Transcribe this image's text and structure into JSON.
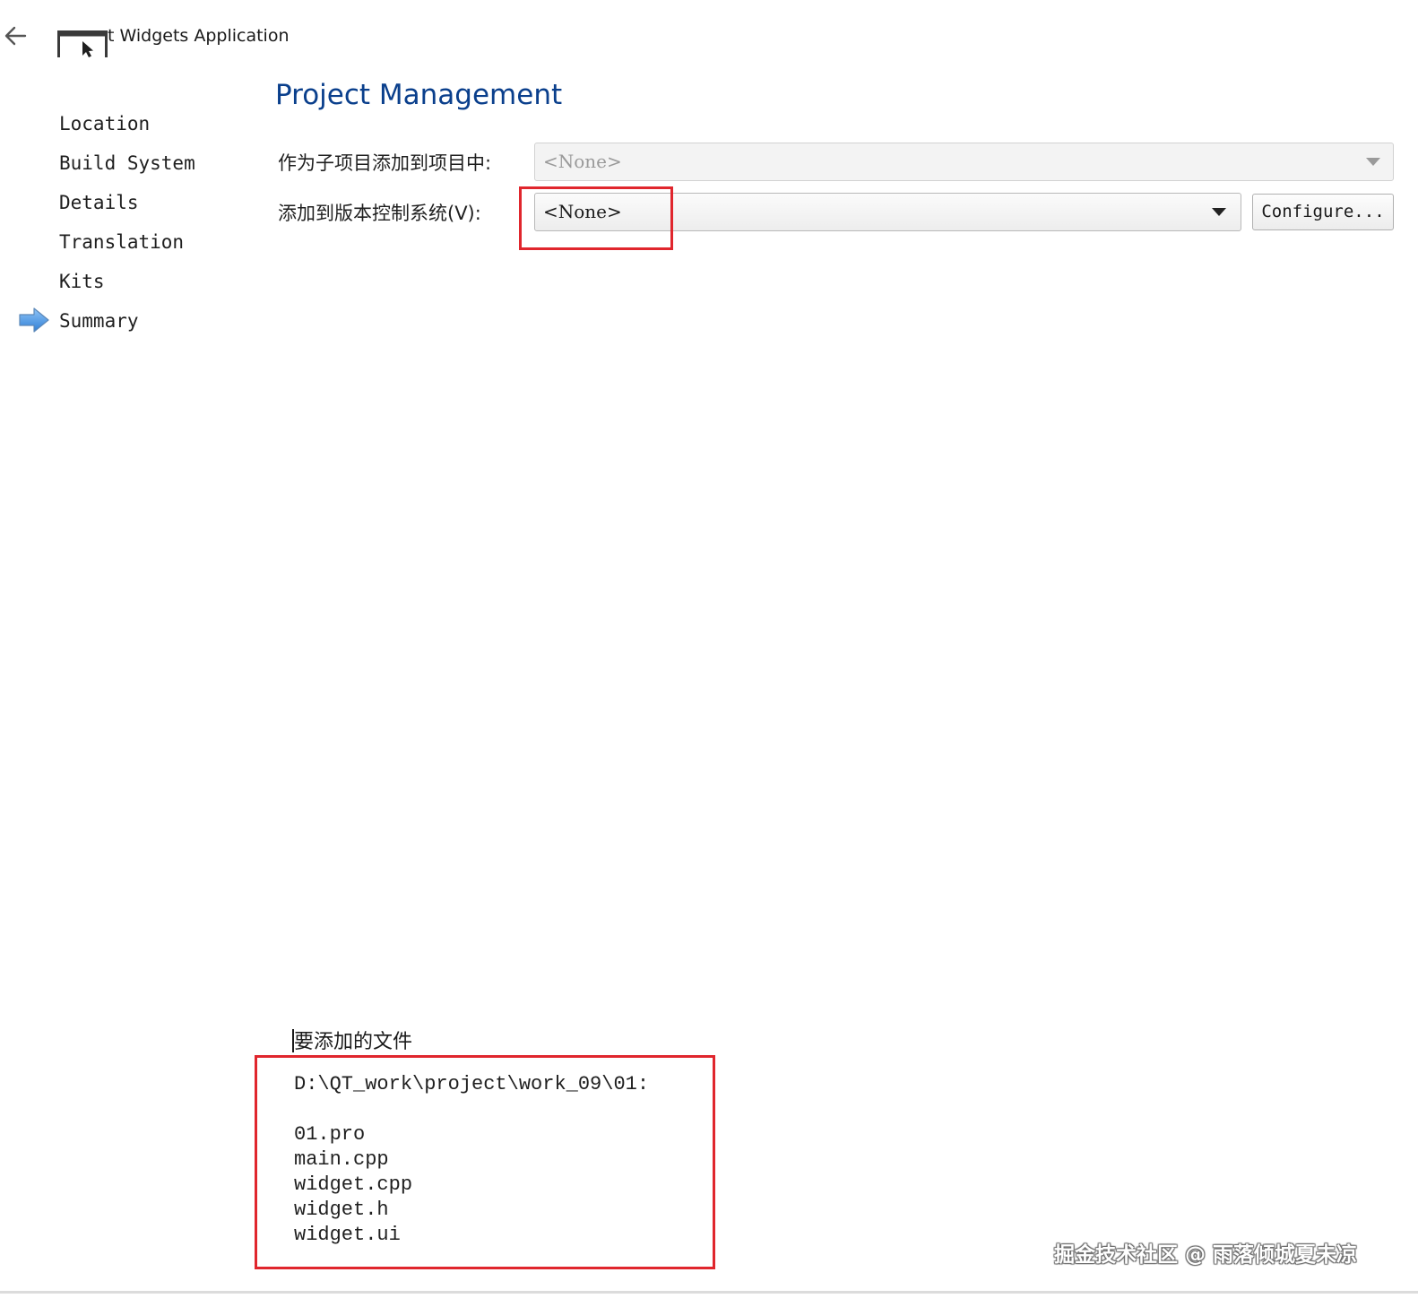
{
  "header": {
    "window_title": "t Widgets Application",
    "back_icon": "arrow-left-icon",
    "app_icon": "window-cursor-icon"
  },
  "steps": {
    "items": [
      {
        "label": "Location"
      },
      {
        "label": "Build System"
      },
      {
        "label": "Details"
      },
      {
        "label": "Translation"
      },
      {
        "label": "Kits"
      },
      {
        "label": "Summary",
        "current": true,
        "indicator_icon": "arrow-right-icon"
      }
    ]
  },
  "main": {
    "title": "Project Management",
    "subproject": {
      "label": "作为子项目添加到项目中:",
      "value": "<None>",
      "enabled": false
    },
    "vcs": {
      "label": "添加到版本控制系统(V):",
      "value": "<None>",
      "configure_button": "Configure..."
    },
    "files": {
      "heading": "要添加的文件",
      "path": "D:\\QT_work\\project\\work_09\\01:",
      "list": [
        "01.pro",
        "main.cpp",
        "widget.cpp",
        "widget.h",
        "widget.ui"
      ]
    }
  },
  "watermark": "掘金技术社区 @ 雨落倾城夏未凉",
  "colors": {
    "title": "#0a3f8c",
    "highlight": "#e0262d",
    "step_indicator": "#3a8be0"
  }
}
